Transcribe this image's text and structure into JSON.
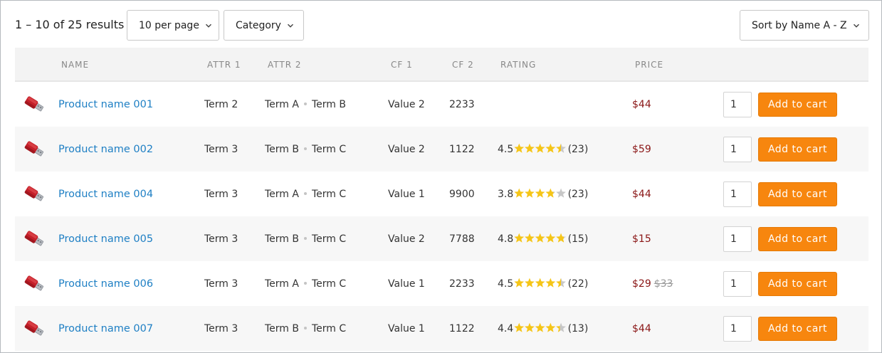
{
  "toolbar": {
    "results_text": "1 – 10 of 25 results",
    "per_page_label": "10 per page",
    "category_label": "Category",
    "sort_label": "Sort by Name A - Z"
  },
  "columns": {
    "name": "NAME",
    "attr1": "ATTR 1",
    "attr2": "ATTR 2",
    "cf1": "CF 1",
    "cf2": "CF 2",
    "rating": "RATING",
    "price": "PRICE"
  },
  "colors": {
    "link": "#1e7fc4",
    "price": "#8a1616",
    "button": "#f7860e",
    "star_filled": "#f5c518",
    "star_empty": "#c7c7c7"
  },
  "rows": [
    {
      "name": "Product name 001",
      "attr1": "Term 2",
      "attr2": [
        "Term A",
        "Term B"
      ],
      "cf1": "Value 2",
      "cf2": "2233",
      "rating": null,
      "rating_text": "",
      "count_text": "",
      "price": "$44",
      "old_price": "",
      "qty": "1",
      "button": "Add to cart"
    },
    {
      "name": "Product name 002",
      "attr1": "Term 3",
      "attr2": [
        "Term B",
        "Term C"
      ],
      "cf1": "Value 2",
      "cf2": "1122",
      "rating": 4.5,
      "rating_text": "4.5",
      "count_text": "(23)",
      "price": "$59",
      "old_price": "",
      "qty": "1",
      "button": "Add to cart"
    },
    {
      "name": "Product name 004",
      "attr1": "Term 3",
      "attr2": [
        "Term A",
        "Term C"
      ],
      "cf1": "Value 1",
      "cf2": "9900",
      "rating": 3.8,
      "rating_text": "3.8",
      "count_text": "(23)",
      "price": "$44",
      "old_price": "",
      "qty": "1",
      "button": "Add to cart"
    },
    {
      "name": "Product name 005",
      "attr1": "Term 3",
      "attr2": [
        "Term B",
        "Term C"
      ],
      "cf1": "Value 2",
      "cf2": "7788",
      "rating": 4.8,
      "rating_text": "4.8",
      "count_text": "(15)",
      "price": "$15",
      "old_price": "",
      "qty": "1",
      "button": "Add to cart"
    },
    {
      "name": "Product name 006",
      "attr1": "Term 3",
      "attr2": [
        "Term A",
        "Term C"
      ],
      "cf1": "Value 1",
      "cf2": "2233",
      "rating": 4.5,
      "rating_text": "4.5",
      "count_text": "(22)",
      "price": "$29",
      "old_price": "$33",
      "qty": "1",
      "button": "Add to cart"
    },
    {
      "name": "Product name 007",
      "attr1": "Term 3",
      "attr2": [
        "Term B",
        "Term C"
      ],
      "cf1": "Value 1",
      "cf2": "1122",
      "rating": 4.4,
      "rating_text": "4.4",
      "count_text": "(13)",
      "price": "$44",
      "old_price": "",
      "qty": "1",
      "button": "Add to cart"
    }
  ]
}
